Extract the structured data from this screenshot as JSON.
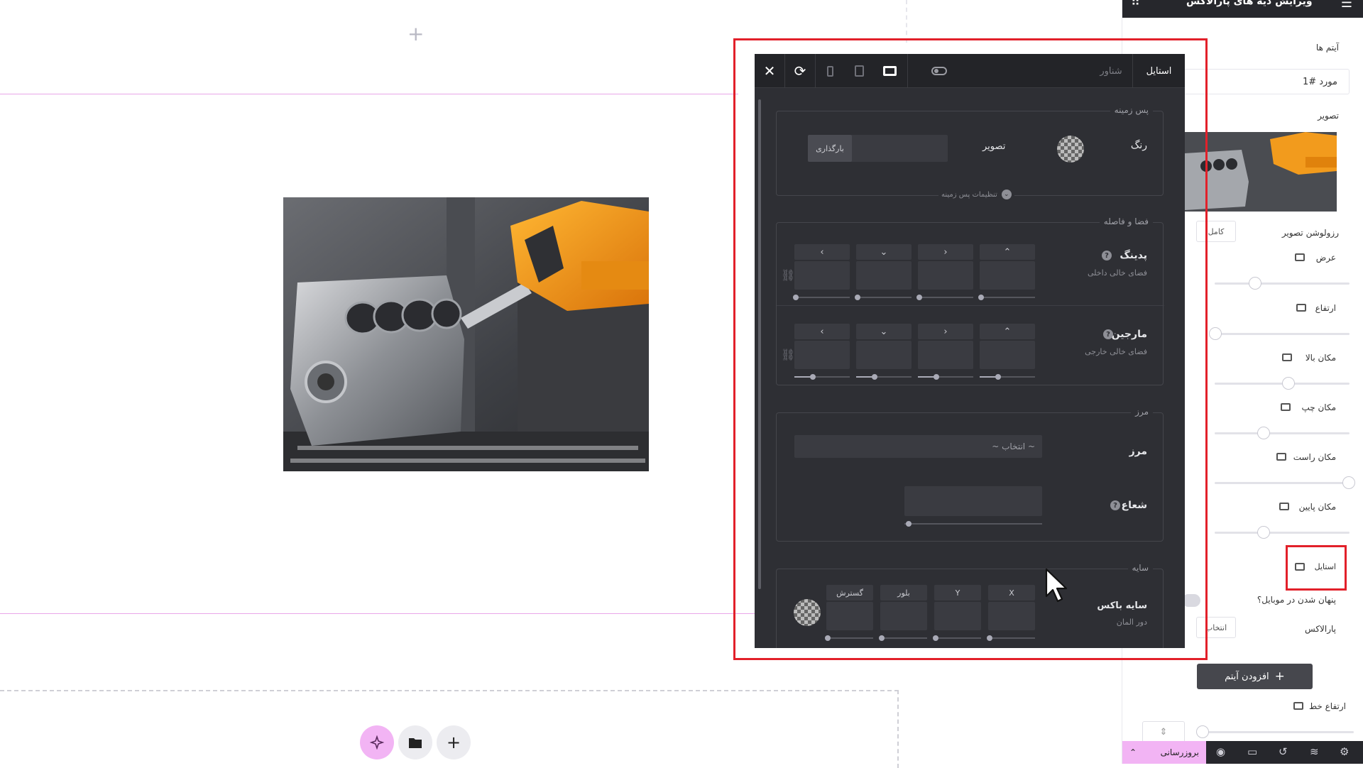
{
  "canvas": {
    "add_icon": "+",
    "image_desc": "engine-block-cnc",
    "fab": [
      "magic-icon",
      "folder-icon",
      "plus-icon"
    ]
  },
  "popup": {
    "tabs": {
      "style": "استایل",
      "shadow": "شناور"
    },
    "background": {
      "title": "پس زمینه",
      "color_label": "رنگ",
      "image_label": "تصویر",
      "upload_label": "بارگذاری",
      "settings_label": "تنظیمات پس زمینه"
    },
    "spacing": {
      "title": "فضا و فاصله",
      "padding_label": "پدینگ",
      "padding_sub": "فضای خالی داخلی",
      "margin_label": "مارجین",
      "margin_sub": "فضای خالی خارجی"
    },
    "border": {
      "title": "مرز",
      "border_label": "مرز",
      "select_placeholder": "~ انتخاب ~",
      "radius_label": "شعاع"
    },
    "shadow": {
      "title": "سایه",
      "box_shadow_label": "سایه باکس",
      "box_shadow_sub": "دور المان",
      "cols": [
        "X",
        "Y",
        "بلور",
        "گسترش"
      ]
    }
  },
  "sidebar": {
    "header_title": "ویرایش دیه های پارالاکس",
    "items_label": "آیتم ها",
    "item_name": "مورد #1",
    "image_label": "تصویر",
    "resolution_label": "رزولوشن تصویر",
    "resolution_value": "کامل",
    "width_label": "عرض",
    "height_label": "ارتفاع",
    "top_label": "مکان بالا",
    "left_label": "مکان چپ",
    "right_label": "مکان راست",
    "bottom_label": "مکان پایین",
    "style_label": "استایل",
    "hide_mobile_label": "پنهان شدن در موبایل؟",
    "parallax_label": "پارالاکس",
    "parallax_value": "انتخاب",
    "add_item_label": "افزودن آیتم",
    "line_height_label": "ارتفاع خط",
    "update_label": "بروزرسانی"
  }
}
